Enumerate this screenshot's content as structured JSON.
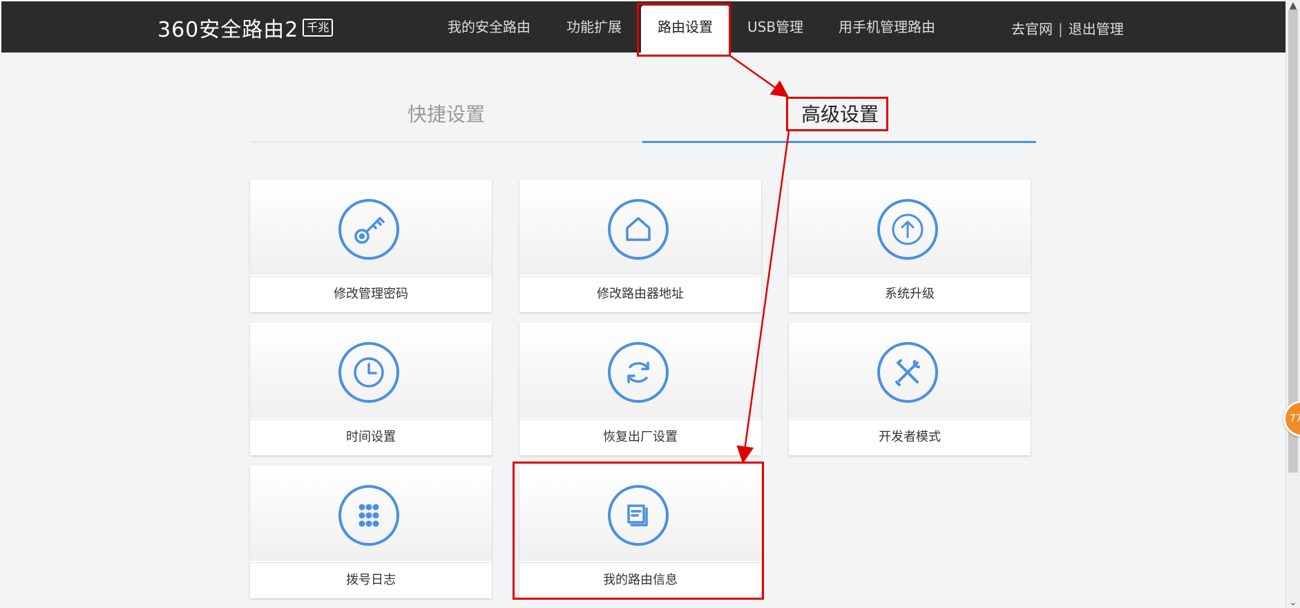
{
  "header": {
    "logo_text": "360安全路由2",
    "logo_badge": "千兆",
    "nav": [
      "我的安全路由",
      "功能扩展",
      "路由设置",
      "USB管理",
      "用手机管理路由"
    ],
    "active_nav": "路由设置",
    "right_links": [
      "去官网",
      "退出管理"
    ],
    "right_separator": "|"
  },
  "tabs": {
    "quick": "快捷设置",
    "advanced": "高级设置"
  },
  "cards": [
    {
      "label": "修改管理密码",
      "icon": "key-icon"
    },
    {
      "label": "修改路由器地址",
      "icon": "home-icon"
    },
    {
      "label": "系统升级",
      "icon": "upgrade-icon"
    },
    {
      "label": "时间设置",
      "icon": "clock-icon"
    },
    {
      "label": "恢复出厂设置",
      "icon": "reset-icon"
    },
    {
      "label": "开发者模式",
      "icon": "tools-icon"
    },
    {
      "label": "拨号日志",
      "icon": "grid-icon"
    },
    {
      "label": "我的路由信息",
      "icon": "info-doc-icon"
    }
  ],
  "floating_badge": "77",
  "colors": {
    "accent": "#4a90e2",
    "topbar": "#2b2b2b",
    "annotation": "#e00000",
    "badge": "#f28c28"
  }
}
